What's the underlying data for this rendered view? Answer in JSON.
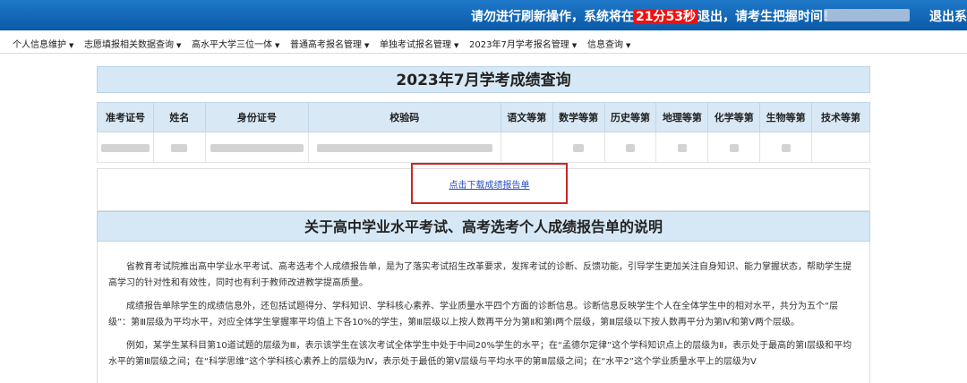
{
  "topbar": {
    "warning_prefix": "请勿进行刷新操作，系统将在",
    "countdown": "21分53秒",
    "warning_suffix": "退出，请考生把握时间！",
    "logout": "退出系统"
  },
  "nav": {
    "items": [
      "个人信息维护",
      "志愿填报相关数据查询",
      "高水平大学三位一体",
      "普通高考报名管理",
      "单独考试报名管理",
      "2023年7月学考报名管理",
      "信息查询"
    ]
  },
  "page": {
    "title": "2023年7月学考成绩查询",
    "download_link": "点击下载成绩报告单",
    "section_title": "关于高中学业水平考试、高考选考个人成绩报告单的说明"
  },
  "table": {
    "headers": [
      "准考证号",
      "姓名",
      "身份证号",
      "校验码",
      "语文等第",
      "数学等第",
      "历史等第",
      "地理等第",
      "化学等第",
      "生物等第",
      "技术等第"
    ]
  },
  "explanation": {
    "paragraphs": [
      "省教育考试院推出高中学业水平考试、高考选考个人成绩报告单，是为了落实考试招生改革要求，发挥考试的诊断、反馈功能，引导学生更加关注自身知识、能力掌握状态，帮助学生提高学习的针对性和有效性，同时也有利于教师改进教学提高质量。",
      "成绩报告单除学生的成绩信息外，还包括试题得分、学科知识、学科核心素养、学业质量水平四个方面的诊断信息。诊断信息反映学生个人在全体学生中的相对水平，共分为五个“层级”：第Ⅲ层级为平均水平，对应全体学生掌握率平均值上下各10%的学生，第Ⅲ层级以上按人数再平分为第Ⅱ和第Ⅰ两个层级，第Ⅲ层级以下按人数再平分为第Ⅳ和第Ⅴ两个层级。",
      "例如，某学生某科目第10道试题的层级为Ⅲ，表示该学生在该次考试全体学生中处于中间20%学生的水平；在“孟德尔定律”这个学科知识点上的层级为Ⅱ，表示处于最高的第Ⅰ层级和平均水平的第Ⅲ层级之间；在“科学思维”这个学科核心素养上的层级为Ⅳ，表示处于最低的第Ⅴ层级与平均水平的第Ⅲ层级之间；在“水平2”这个学业质量水平上的层级为Ⅴ"
    ]
  },
  "colors": {
    "topbar": "#0a5aa8",
    "countdown_bg": "#e11111",
    "header_bg": "#d6e8f5",
    "highlight_border": "#c62828",
    "link": "#2a4fc0"
  }
}
